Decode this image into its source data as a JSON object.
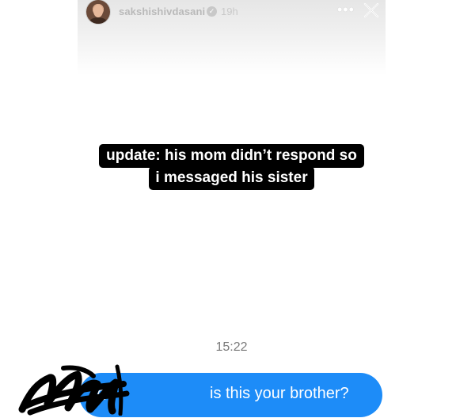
{
  "story": {
    "username": "sakshishivdasani",
    "verified_badge": "✓",
    "time_ago": "19h",
    "more_label": "•••",
    "close_icon": "close-icon"
  },
  "caption": {
    "line1": "update: his mom didn’t respond so",
    "line2": "i messaged his sister"
  },
  "message": {
    "timestamp": "15:22",
    "at_symbol": "@",
    "text": "is this your brother?"
  },
  "colors": {
    "bubble": "#1d8cf8",
    "caption_bg": "#000000",
    "header_text": "#b9b9b9"
  }
}
